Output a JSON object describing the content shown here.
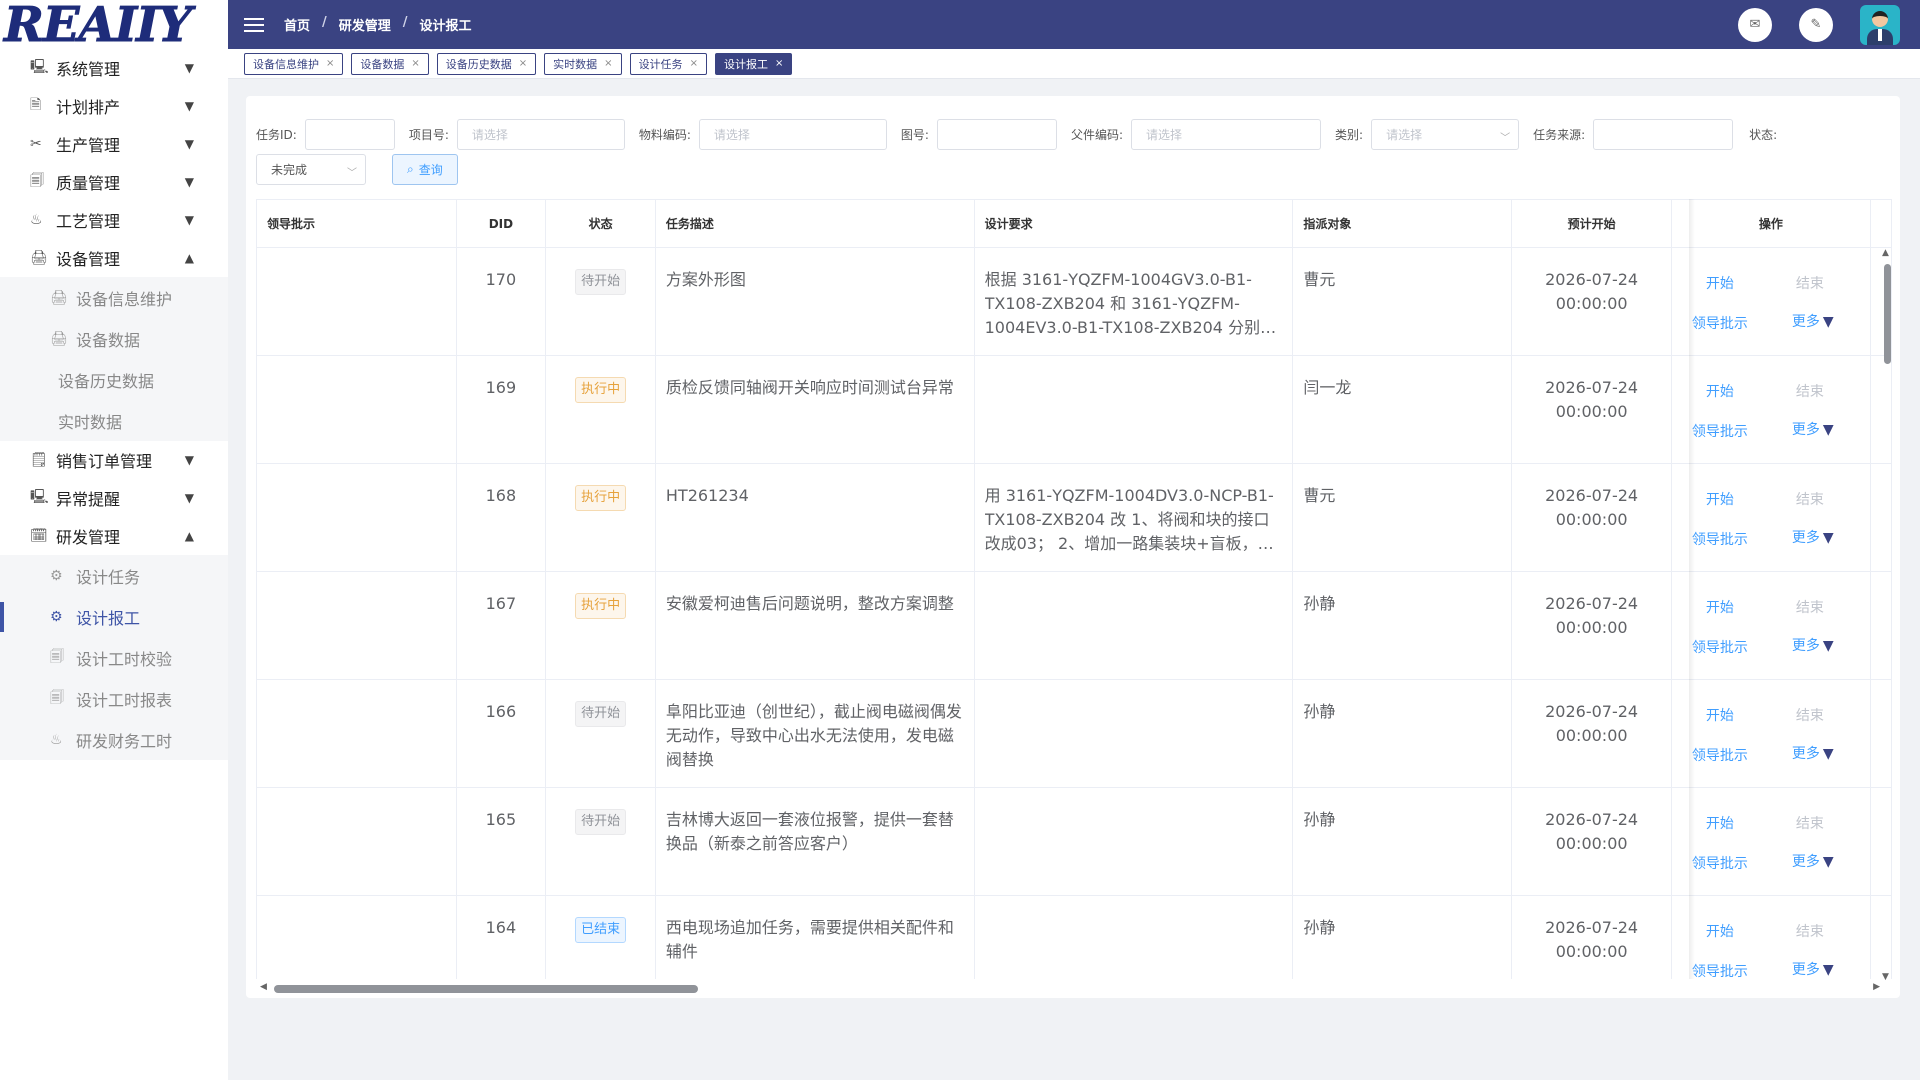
{
  "logo": {
    "text": "REAIIY"
  },
  "sidebar": {
    "menus": [
      {
        "icon": "🖳",
        "label": "系统管理",
        "caret": "▼"
      },
      {
        "icon": "🗎",
        "label": "计划排产",
        "caret": "▼"
      },
      {
        "icon": "✂",
        "label": "生产管理",
        "caret": "▼"
      },
      {
        "icon": "🗐",
        "label": "质量管理",
        "caret": "▼"
      },
      {
        "icon": "♨",
        "label": "工艺管理",
        "caret": "▼"
      },
      {
        "icon": "🖨",
        "label": "设备管理",
        "caret": "▲"
      },
      {
        "icon": "🗒",
        "label": "销售订单管理",
        "caret": "▼"
      },
      {
        "icon": "🖳",
        "label": "异常提醒",
        "caret": "▼"
      },
      {
        "icon": "🗓",
        "label": "研发管理",
        "caret": "▲"
      }
    ],
    "equipment_sub": [
      {
        "icon": "🖨",
        "label": "设备信息维护"
      },
      {
        "icon": "🖨",
        "label": "设备数据"
      },
      {
        "label": "设备历史数据"
      },
      {
        "label": "实时数据"
      }
    ],
    "rd_sub": [
      {
        "icon": "⚙",
        "label": "设计任务"
      },
      {
        "icon": "⚙",
        "label": "设计报工"
      },
      {
        "icon": "🗐",
        "label": "设计工时校验"
      },
      {
        "icon": "🗐",
        "label": "设计工时报表"
      },
      {
        "icon": "♨",
        "label": "研发财务工时"
      }
    ]
  },
  "topbar": {
    "breadcrumb": [
      "首页",
      "研发管理",
      "设计报工"
    ],
    "sep": "/"
  },
  "tabs": [
    {
      "label": "设备信息维护"
    },
    {
      "label": "设备数据"
    },
    {
      "label": "设备历史数据"
    },
    {
      "label": "实时数据"
    },
    {
      "label": "设计任务"
    },
    {
      "label": "设计报工"
    }
  ],
  "tab_close": "×",
  "filters": {
    "task_id_label": "任务ID:",
    "project_label": "项目号:",
    "project_ph": "请选择",
    "material_label": "物料编码:",
    "material_ph": "请选择",
    "drawing_label": "图号:",
    "parent_label": "父件编码:",
    "parent_ph": "请选择",
    "category_label": "类别:",
    "category_ph": "请选择",
    "source_label": "任务来源:",
    "status_label": "状态:",
    "status_value": "未完成",
    "query_label": "查询"
  },
  "table": {
    "headers": {
      "approval": "领导批示",
      "did": "DID",
      "status": "状态",
      "desc": "任务描述",
      "req": "设计要求",
      "assignee": "指派对象",
      "start": "预计开始",
      "ops": "操作"
    },
    "op_labels": {
      "start": "开始",
      "end": "结束",
      "approve": "领导批示",
      "more": "更多"
    },
    "rows": [
      {
        "did": "170",
        "status": "待开始",
        "tag": "gray",
        "desc": "方案外形图",
        "req": "根据 3161-YQZFM-1004GV3.0-B1-TX108-ZXB204 和 3161-YQZFM-1004EV3.0-B1-TX108-ZXB204 分别出…",
        "assignee": "曹元",
        "start_date": "2026-07-24",
        "start_time": "00:00:00"
      },
      {
        "did": "169",
        "status": "执行中",
        "tag": "orange",
        "desc": "质检反馈同轴阀开关响应时间测试台异常",
        "req": "",
        "assignee": "闫一龙",
        "start_date": "2026-07-24",
        "start_time": "00:00:00"
      },
      {
        "did": "168",
        "status": "执行中",
        "tag": "orange",
        "desc": "HT261234",
        "req": "用 3161-YQZFM-1004DV3.0-NCP-B1-TX108-ZXB204 改 1、将阀和块的接口改成03； 2、增加一路集装块+盲板，盲…",
        "assignee": "曹元",
        "start_date": "2026-07-24",
        "start_time": "00:00:00"
      },
      {
        "did": "167",
        "status": "执行中",
        "tag": "orange",
        "desc": "安徽爱柯迪售后问题说明，整改方案调整",
        "req": "",
        "assignee": "孙静",
        "start_date": "2026-07-24",
        "start_time": "00:00:00"
      },
      {
        "did": "166",
        "status": "待开始",
        "tag": "gray",
        "desc": "阜阳比亚迪（创世纪），截止阀电磁阀偶发无动作，导致中心出水无法使用，发电磁阀替换",
        "req": "",
        "assignee": "孙静",
        "start_date": "2026-07-24",
        "start_time": "00:00:00"
      },
      {
        "did": "165",
        "status": "待开始",
        "tag": "gray",
        "desc": "吉林博大返回一套液位报警，提供一套替换品（新泰之前答应客户）",
        "req": "",
        "assignee": "孙静",
        "start_date": "2026-07-24",
        "start_time": "00:00:00"
      },
      {
        "did": "164",
        "status": "已结束",
        "tag": "blue",
        "desc": "西电现场追加任务，需要提供相关配件和辅件",
        "req": "",
        "assignee": "孙静",
        "start_date": "2026-07-24",
        "start_time": "00:00:00"
      }
    ]
  }
}
